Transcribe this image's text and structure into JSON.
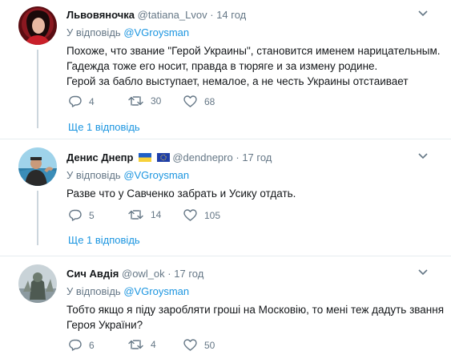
{
  "tweets": [
    {
      "name": "Львовяночка",
      "handle": "@tatiana_Lvov",
      "separator": "·",
      "time": "14 год",
      "replying_prefix": "У відповідь",
      "replying_to": "@VGroysman",
      "text": [
        "Похоже, что звание \"Герой Украины\", становится именем нарицательным.",
        "Гадежда тоже его носит, правда в тюряге и за измену родине.",
        "Герой за бабло выступает, немалое, а не честь Украины отстаивает"
      ],
      "replies": "4",
      "retweets": "30",
      "likes": "68",
      "more_replies": "Ще 1 відповідь"
    },
    {
      "name": "Денис Днепр",
      "handle": "@dendnepro",
      "separator": "·",
      "time": "17 год",
      "replying_prefix": "У відповідь",
      "replying_to": "@VGroysman",
      "text": [
        "Разве что у Савченко забрать и Усику отдать."
      ],
      "replies": "5",
      "retweets": "14",
      "likes": "105",
      "more_replies": "Ще 1 відповідь"
    },
    {
      "name": "Сич Авдія",
      "handle": "@owl_ok",
      "separator": "·",
      "time": "17 год",
      "replying_prefix": "У відповідь",
      "replying_to": "@VGroysman",
      "text": [
        "Тобто якщо я піду заробляти гроші на Московію, то мені теж дадуть звання",
        "Героя України?"
      ],
      "replies": "6",
      "retweets": "4",
      "likes": "50"
    }
  ],
  "icons": {
    "reply": "reply-icon",
    "retweet": "retweet-icon",
    "like": "heart-icon",
    "caret": "chevron-down-icon",
    "flags": [
      "ukraine-flag-icon",
      "eu-flag-icon"
    ]
  },
  "colors": {
    "link": "#1b95e0",
    "muted": "#657786",
    "thread_line": "#ccd6dd",
    "separator": "#e6ecf0"
  }
}
